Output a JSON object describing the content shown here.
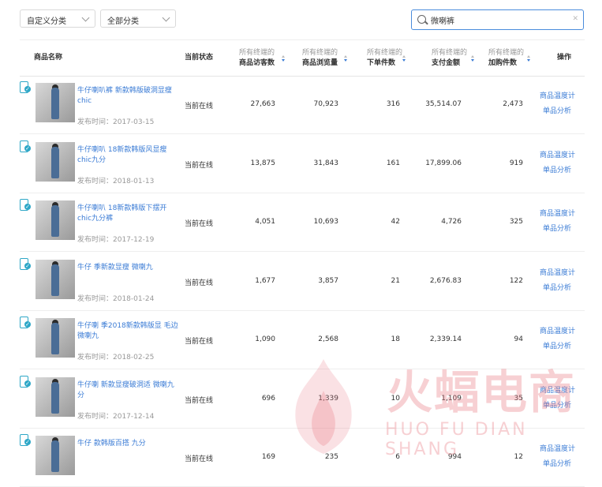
{
  "filters": {
    "category_custom": "自定义分类",
    "category_all": "全部分类",
    "search_value": "微喇裤"
  },
  "table": {
    "headers": {
      "name": "商品名称",
      "status": "当前状态",
      "visitors_sub": "所有终端的",
      "visitors": "商品访客数",
      "views_sub": "所有终端的",
      "views": "商品浏览量",
      "orders_sub": "所有终端的",
      "orders": "下单件数",
      "paid_sub": "所有终端的",
      "paid": "支付金额",
      "cart_sub": "所有终端的",
      "cart": "加购件数",
      "action": "操作"
    },
    "rows": [
      {
        "name": "牛仔喇叭裤 新款韩版破洞显瘦 chic",
        "date": "发布时间：2017-03-15",
        "status": "当前在线",
        "visitors": "27,663",
        "views": "70,923",
        "orders": "316",
        "paid": "35,514.07",
        "cart": "2,473",
        "action1": "商品温度计",
        "action2": "单品分析"
      },
      {
        "name": "牛仔喇叭 18新款韩版风显瘦 chic九分",
        "date": "发布时间：2018-01-13",
        "status": "当前在线",
        "visitors": "13,875",
        "views": "31,843",
        "orders": "161",
        "paid": "17,899.06",
        "cart": "919",
        "action1": "商品温度计",
        "action2": "单品分析"
      },
      {
        "name": "牛仔喇叭 18新款韩版下摆开 chic九分裤",
        "date": "发布时间：2017-12-19",
        "status": "当前在线",
        "visitors": "4,051",
        "views": "10,693",
        "orders": "42",
        "paid": "4,726",
        "cart": "325",
        "action1": "商品温度计",
        "action2": "单品分析"
      },
      {
        "name": "牛仔 季新款显瘦 微喇九",
        "date": "发布时间：2018-01-24",
        "status": "当前在线",
        "visitors": "1,677",
        "views": "3,857",
        "orders": "21",
        "paid": "2,676.83",
        "cart": "122",
        "action1": "商品温度计",
        "action2": "单品分析"
      },
      {
        "name": "牛仔喇 季2018新款韩版显 毛边微喇九",
        "date": "发布时间：2018-02-25",
        "status": "当前在线",
        "visitors": "1,090",
        "views": "2,568",
        "orders": "18",
        "paid": "2,339.14",
        "cart": "94",
        "action1": "商品温度计",
        "action2": "单品分析"
      },
      {
        "name": "牛仔喇 新款显瘦破洞适 微喇九分",
        "date": "发布时间：2017-12-14",
        "status": "当前在线",
        "visitors": "696",
        "views": "1,339",
        "orders": "10",
        "paid": "1,109",
        "cart": "35",
        "action1": "商品温度计",
        "action2": "单品分析"
      },
      {
        "name": "牛仔 款韩版百搭 九分",
        "date": "",
        "status": "当前在线",
        "visitors": "169",
        "views": "235",
        "orders": "6",
        "paid": "994",
        "cart": "12",
        "action1": "商品温度计",
        "action2": "单品分析"
      }
    ]
  },
  "watermark": {
    "title": "火蝠电商",
    "subtitle": "HUO FU DIAN SHANG"
  }
}
